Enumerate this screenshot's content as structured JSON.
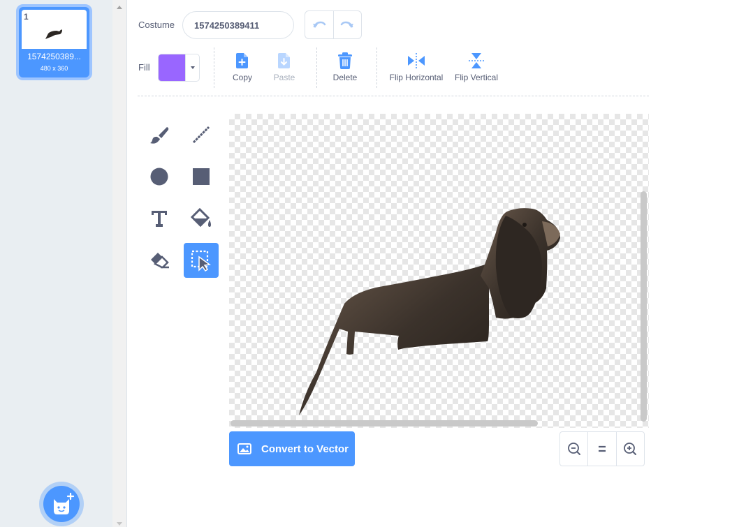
{
  "costume_list": {
    "items": [
      {
        "number": "1",
        "name": "1574250389...",
        "size": "480 x 360",
        "selected": true
      }
    ],
    "add_button_icon": "cat-plus-icon"
  },
  "toolbar": {
    "costume_label": "Costume",
    "costume_name": "1574250389411",
    "undo_icon": "undo-icon",
    "redo_icon": "redo-icon",
    "fill_label": "Fill",
    "fill_color": "#9966ff",
    "copy_label": "Copy",
    "paste_label": "Paste",
    "delete_label": "Delete",
    "flip_horizontal_label": "Flip Horizontal",
    "flip_vertical_label": "Flip Vertical"
  },
  "tools": [
    {
      "name": "brush",
      "icon": "brush-icon",
      "selected": false
    },
    {
      "name": "line",
      "icon": "line-icon",
      "selected": false
    },
    {
      "name": "circle",
      "icon": "circle-icon",
      "selected": false
    },
    {
      "name": "rectangle",
      "icon": "rectangle-icon",
      "selected": false
    },
    {
      "name": "text",
      "icon": "text-icon",
      "selected": false
    },
    {
      "name": "fill",
      "icon": "paint-bucket-icon",
      "selected": false
    },
    {
      "name": "eraser",
      "icon": "eraser-icon",
      "selected": false
    },
    {
      "name": "select",
      "icon": "select-icon",
      "selected": true
    }
  ],
  "canvas": {
    "convert_label": "Convert to Vector",
    "zoom_out_icon": "zoom-out-icon",
    "zoom_reset_icon": "zoom-reset-icon",
    "zoom_in_icon": "zoom-in-icon"
  },
  "colors": {
    "accent": "#4c97ff",
    "text": "#575e75",
    "fill": "#9966ff"
  }
}
